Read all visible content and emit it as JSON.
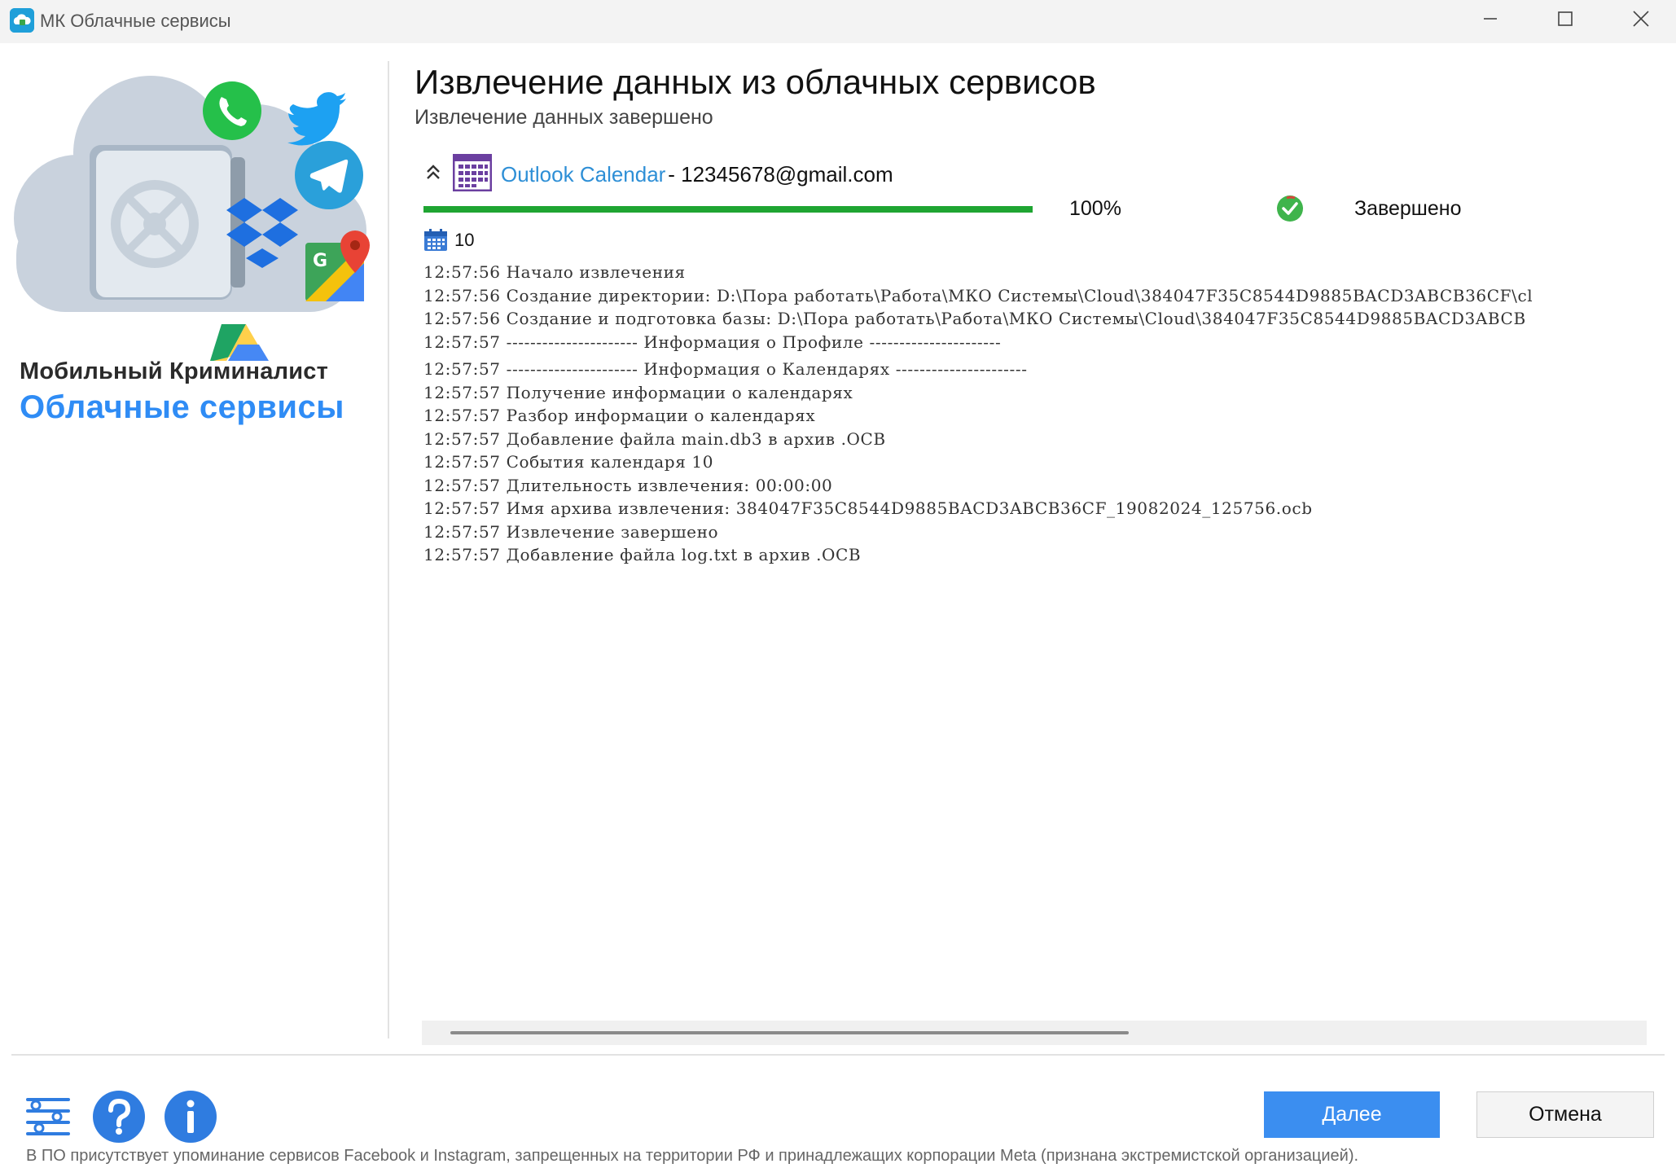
{
  "window": {
    "title": "МК Облачные сервисы"
  },
  "branding": {
    "line1": "Мобильный Криминалист",
    "line2": "Облачные сервисы"
  },
  "main": {
    "title": "Извлечение данных из облачных сервисов",
    "subtitle": "Извлечение данных завершено"
  },
  "task": {
    "service_name": "Outlook Calendar",
    "account": " - 12345678@gmail.com",
    "progress_percent": 100,
    "progress_label": "100%",
    "status": "Завершено",
    "item_count": "10"
  },
  "log": [
    "12:57:56 Начало извлечения",
    "12:57:56 Создание директории: D:\\Пора работать\\Работа\\МКО Системы\\Cloud\\384047F35C8544D9885BACD3ABCB36CF\\cl",
    "12:57:56 Создание и подготовка базы: D:\\Пора работать\\Работа\\МКО Системы\\Cloud\\384047F35C8544D9885BACD3ABCB",
    "12:57:57 ---------------------- Информация о Профиле ----------------------",
    "12:57:57 ---------------------- Информация о Календарях ----------------------",
    "12:57:57 Получение информации о календарях",
    "12:57:57 Разбор информации о календарях",
    "12:57:57 Добавление файла main.db3 в архив .OCB",
    "12:57:57 События календаря 10",
    "12:57:57 Длительность извлечения: 00:00:00",
    "12:57:57 Имя архива извлечения: 384047F35C8544D9885BACD3ABCB36CF_19082024_125756.ocb",
    "12:57:57 Извлечение завершено",
    "12:57:57 Добавление файла log.txt в архив .OCB"
  ],
  "buttons": {
    "next": "Далее",
    "cancel": "Отмена"
  },
  "footer": {
    "disclaimer": "В ПО присутствует упоминание сервисов Facebook и Instagram, запрещенных на территории РФ и принадлежащих корпорации Meta (признана экстремистской организацией)."
  },
  "icons": {
    "app": "cloud-app-icon",
    "collapse": "double-chevron-up-icon",
    "service": "calendar-icon",
    "status": "check-circle-icon",
    "count": "calendar-small-icon",
    "settings": "settings-sliders-icon",
    "help": "help-icon",
    "info": "info-icon"
  },
  "colors": {
    "accent": "#3b8ef0",
    "brand_blue": "#2f8cf5",
    "link": "#2e8fd6",
    "progress": "#1fa532",
    "service_icon": "#6b3fa0"
  }
}
